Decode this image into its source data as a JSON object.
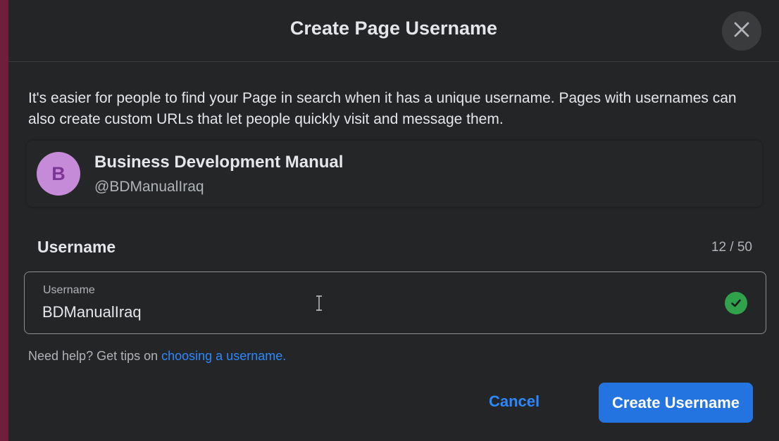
{
  "dialog": {
    "title": "Create Page Username",
    "close_icon": "close-icon",
    "description": "It's easier for people to find your Page in search when it has a unique username. Pages with usernames can also create custom URLs that let people quickly visit and message them."
  },
  "page": {
    "avatar_letter": "B",
    "name": "Business Development Manual",
    "handle": "@BDManualIraq"
  },
  "username": {
    "section_label": "Username",
    "char_count": "12 / 50",
    "input_label": "Username",
    "input_value": "BDManualIraq",
    "status_icon": "checkmark-circle-icon"
  },
  "help": {
    "prefix": "Need help? Get tips on ",
    "link": "choosing a username."
  },
  "actions": {
    "cancel": "Cancel",
    "create": "Create Username"
  },
  "colors": {
    "background": "#242526",
    "accent": "#2374e1",
    "link": "#2d88ff",
    "success": "#31a24c",
    "avatar": "#c58bd8"
  }
}
